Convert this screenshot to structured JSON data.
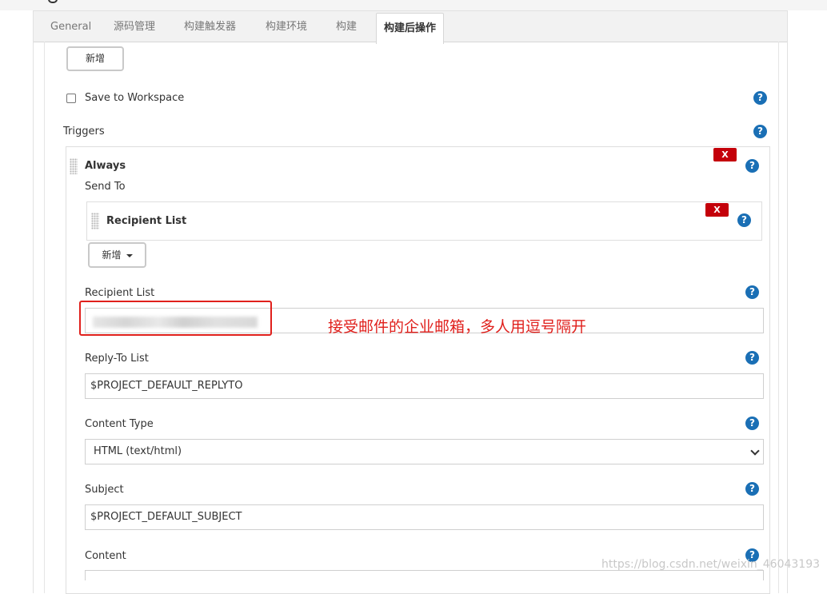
{
  "tabs": [
    {
      "label": "General",
      "active": false
    },
    {
      "label": "源码管理",
      "active": false
    },
    {
      "label": "构建触发器",
      "active": false
    },
    {
      "label": "构建环境",
      "active": false
    },
    {
      "label": "构建",
      "active": false
    },
    {
      "label": "构建后操作",
      "active": true
    }
  ],
  "add_button_label": "新增",
  "save_to_workspace": {
    "label": "Save to Workspace",
    "checked": false
  },
  "triggers": {
    "label": "Triggers",
    "trigger_name": "Always",
    "send_to_label": "Send To",
    "delete_label": "X",
    "recipient_list_item": "Recipient List",
    "add_dropdown_label": "新增"
  },
  "fields": {
    "recipient_list": {
      "label": "Recipient List",
      "value": ""
    },
    "reply_to": {
      "label": "Reply-To List",
      "value": "$PROJECT_DEFAULT_REPLYTO"
    },
    "content_type": {
      "label": "Content Type",
      "value": "HTML (text/html)"
    },
    "subject": {
      "label": "Subject",
      "value": "$PROJECT_DEFAULT_SUBJECT"
    },
    "content": {
      "label": "Content",
      "value": ""
    }
  },
  "help_label": "?",
  "annotation": "接受邮件的企业邮箱，多人用逗号隔开",
  "watermark": "https://blog.csdn.net/weixin_46043193",
  "colors": {
    "accent": "#1a6fb5",
    "danger": "#c4000a",
    "annotation": "#e0201c"
  }
}
